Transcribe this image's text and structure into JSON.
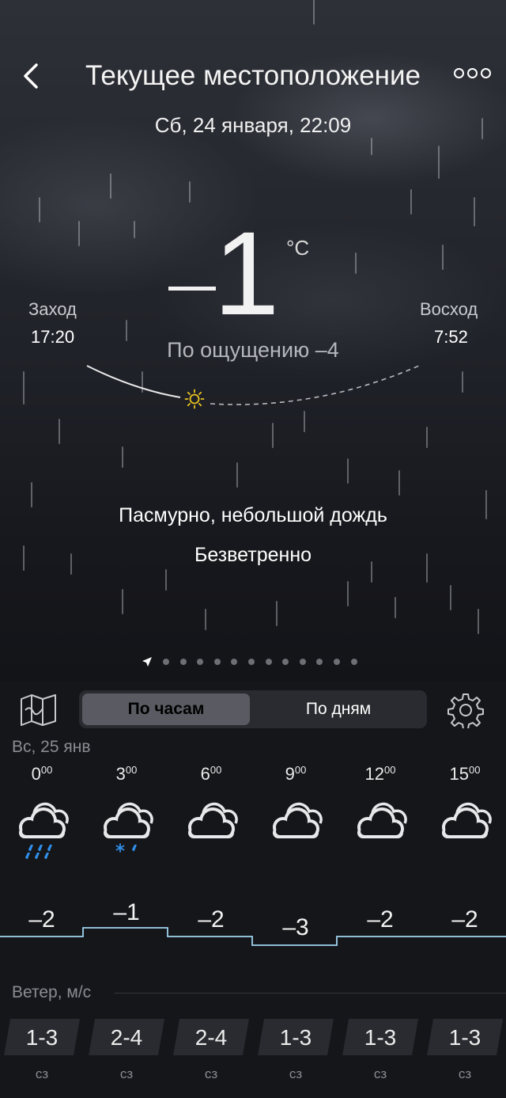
{
  "header": {
    "title": "Текущее местоположение",
    "date": "Сб, 24 января, 22:09"
  },
  "current": {
    "temperature": "1",
    "unit": "°C",
    "feels_like": "По ощущению –4",
    "condition": "Пасмурно, небольшой дождь",
    "wind": "Безветренно"
  },
  "sun": {
    "sunset_label": "Заход",
    "sunset_time": "17:20",
    "sunrise_label": "Восход",
    "sunrise_time": "7:52"
  },
  "tabs": {
    "hourly": "По часам",
    "daily": "По дням"
  },
  "forecast": {
    "day_label": "Вс, 25 янв",
    "hours": [
      {
        "hour": "0",
        "min": "00",
        "icon": "cloud-rain-icon",
        "temp": "–2"
      },
      {
        "hour": "3",
        "min": "00",
        "icon": "cloud-sleet-icon",
        "temp": "–1"
      },
      {
        "hour": "6",
        "min": "00",
        "icon": "cloud-icon",
        "temp": "–2"
      },
      {
        "hour": "9",
        "min": "00",
        "icon": "cloud-icon",
        "temp": "–3"
      },
      {
        "hour": "12",
        "min": "00",
        "icon": "cloud-icon",
        "temp": "–2"
      },
      {
        "hour": "15",
        "min": "00",
        "icon": "cloud-icon",
        "temp": "–2"
      }
    ]
  },
  "wind": {
    "title": "Ветер, м/с",
    "items": [
      {
        "speed": "1-3",
        "dir": "сз"
      },
      {
        "speed": "2-4",
        "dir": "сз"
      },
      {
        "speed": "2-4",
        "dir": "сз"
      },
      {
        "speed": "1-3",
        "dir": "сз"
      },
      {
        "speed": "1-3",
        "dir": "сз"
      },
      {
        "speed": "1-3",
        "dir": "сз"
      }
    ]
  },
  "colors": {
    "rain_drop": "#2f8fe8",
    "temp_line": "#9fd3ee",
    "sun": "#e8c420"
  }
}
